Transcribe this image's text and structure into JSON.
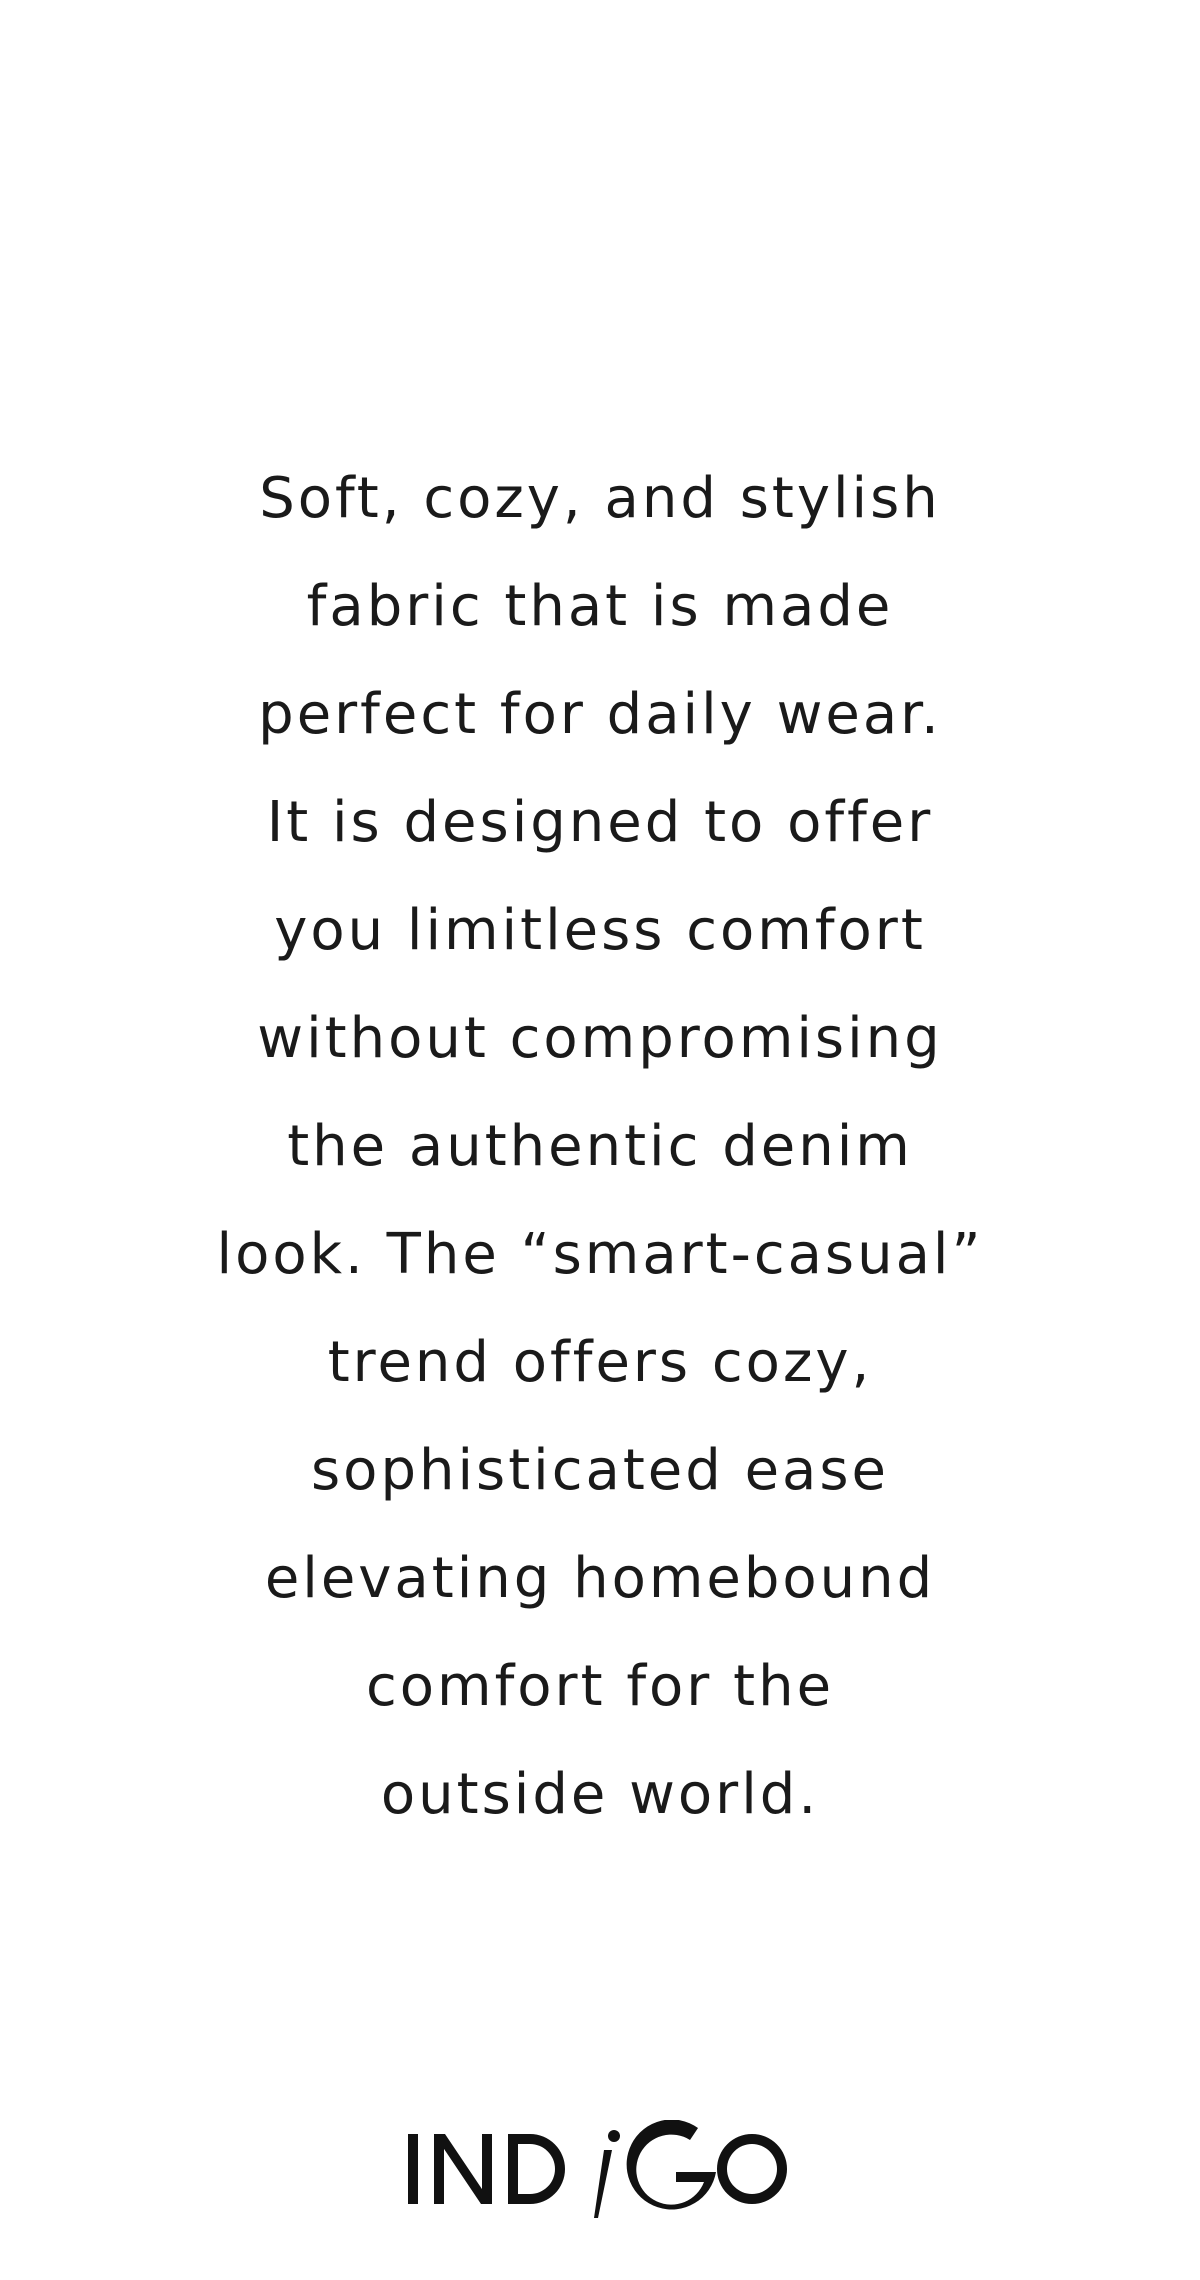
{
  "body_copy": {
    "lines": [
      "Soft, cozy, and stylish",
      "fabric that is made",
      "perfect for daily wear.",
      "It is designed to offer",
      "you limitless comfort",
      "without compromising",
      "the authentic denim",
      "look. The “smart-casual”",
      "trend offers cozy,",
      "sophisticated ease",
      "elevating homebound",
      "comfort for the",
      "outside world."
    ]
  },
  "brand": {
    "logo_text": "INDIGO",
    "logo_icon": "indigo-wordmark",
    "color": "#111111"
  },
  "colors": {
    "background": "#ffffff",
    "text": "#1a1a1a"
  }
}
